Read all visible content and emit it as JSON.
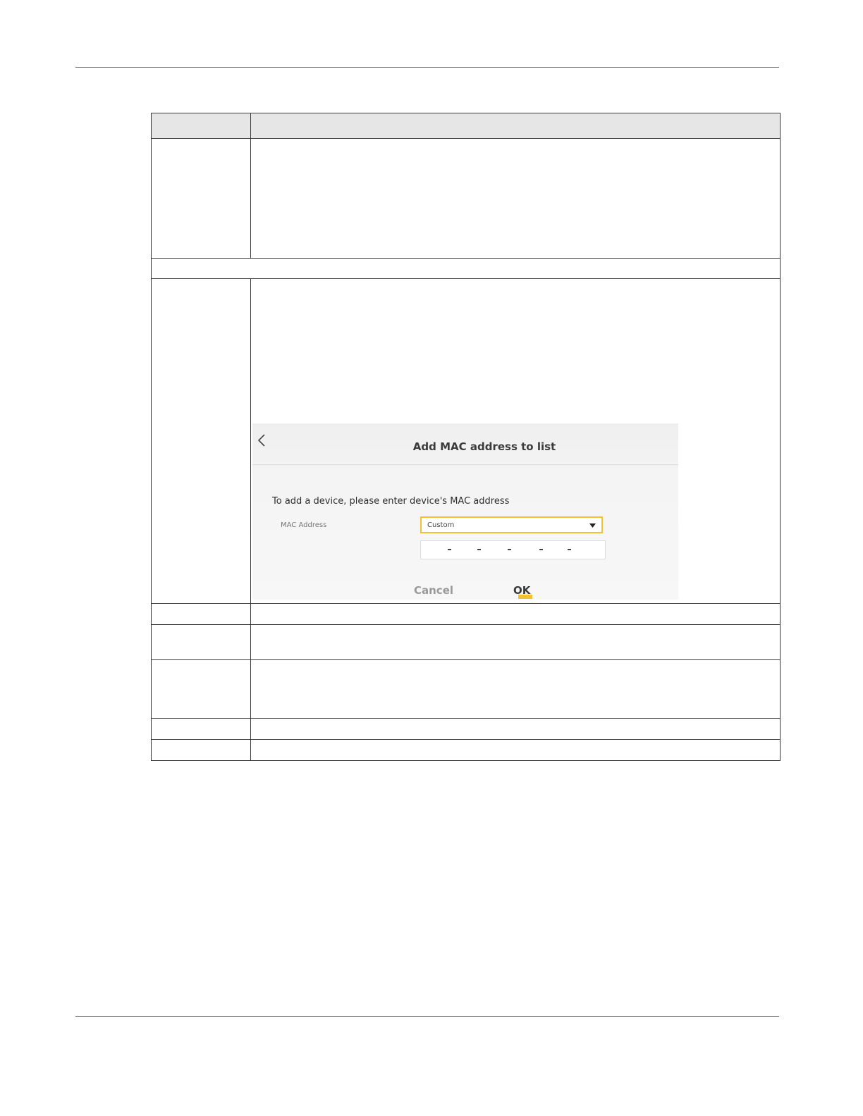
{
  "screenshot": {
    "title": "Add MAC address to list",
    "instruction": "To add a device, please enter device's MAC address",
    "mac_address_label": "MAC Address",
    "mac_select_value": "Custom",
    "mac_separators": [
      "-",
      "-",
      "-",
      "-",
      "-"
    ],
    "cancel_label": "Cancel",
    "ok_label": "OK",
    "icons": {
      "back": "chevron-left-icon",
      "dropdown": "caret-down-icon"
    },
    "colors": {
      "accent": "#f2c230"
    }
  }
}
